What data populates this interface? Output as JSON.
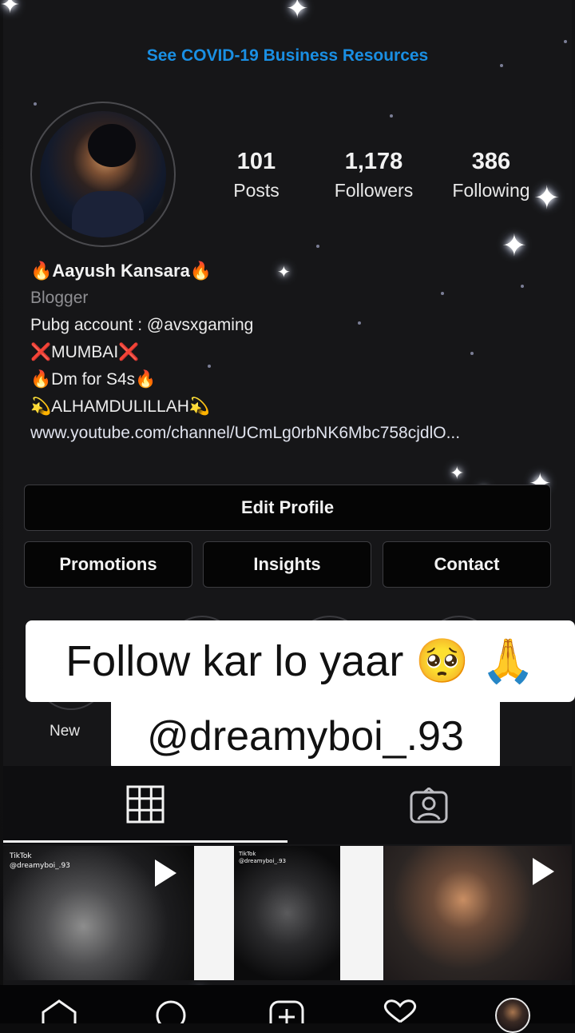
{
  "banner": {
    "covid_link": "See COVID-19 Business Resources"
  },
  "profile": {
    "name": "🔥Aayush Kansara🔥",
    "category": "Blogger",
    "bio": [
      "Pubg account : @avsxgaming",
      "❌MUMBAI❌",
      "🔥Dm for S4s🔥",
      "💫ALHAMDULILLAH💫"
    ],
    "link": "www.youtube.com/channel/UCmLg0rbNK6Mbc758cjdlO..."
  },
  "stats": [
    {
      "value": "101",
      "label": "Posts"
    },
    {
      "value": "1,178",
      "label": "Followers"
    },
    {
      "value": "386",
      "label": "Following"
    }
  ],
  "buttons": {
    "edit_profile": "Edit Profile",
    "promotions": "Promotions",
    "insights": "Insights",
    "contact": "Contact"
  },
  "highlights": {
    "new_label": "New"
  },
  "caption": {
    "line1": "Follow kar lo yaar 🥺 🙏",
    "line2": "@dreamyboi_.93"
  },
  "posts": [
    {
      "watermark": "TikTok",
      "handle": "@dreamyboi_.93",
      "type": "video"
    },
    {
      "watermark": "TikTok",
      "handle": "@dreamyboi_.93",
      "type": "video"
    },
    {
      "watermark": "",
      "handle": "",
      "type": "video"
    }
  ],
  "tabs": [
    {
      "icon": "grid-icon"
    },
    {
      "icon": "tagged-icon"
    }
  ],
  "bottom_nav": [
    {
      "icon": "home-icon"
    },
    {
      "icon": "search-icon"
    },
    {
      "icon": "add-post-icon"
    },
    {
      "icon": "heart-icon"
    },
    {
      "icon": "profile-avatar-icon"
    }
  ],
  "colors": {
    "accent_blue": "#1a8fe3",
    "background": "#161618",
    "button_bg": "#050505",
    "muted_text": "#8e8e92"
  }
}
